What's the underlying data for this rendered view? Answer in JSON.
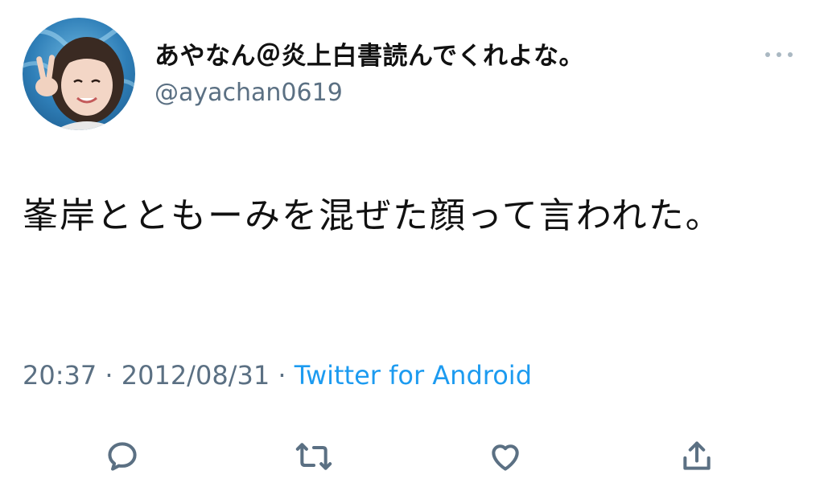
{
  "user": {
    "display_name": "あやなん＠炎上白書読んでくれよな。",
    "handle": "@ayachan0619"
  },
  "tweet": {
    "text": "峯岸とともーみを混ぜた顔って言われた。",
    "time": "20:37",
    "separator": "·",
    "date": "2012/08/31",
    "source": "Twitter for Android"
  },
  "icons": {
    "more": "more-horizontal-icon",
    "reply": "reply-icon",
    "retweet": "retweet-icon",
    "like": "heart-icon",
    "share": "share-icon"
  },
  "colors": {
    "text": "#111111",
    "secondary": "#5b7083",
    "link": "#1d9bf0"
  }
}
